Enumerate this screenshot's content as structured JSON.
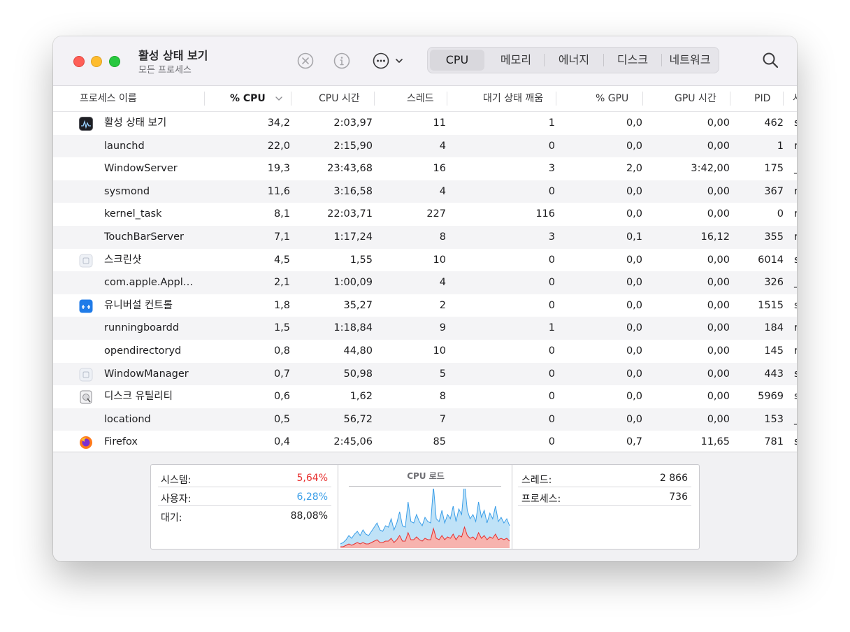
{
  "window": {
    "title": "활성 상태 보기",
    "subtitle": "모든 프로세스"
  },
  "toolbar": {
    "stop_icon": "xmark-circle-icon",
    "info_icon": "info-circle-icon",
    "more_icon": "ellipsis-circle-icon",
    "search_icon": "magnifying-glass-icon",
    "tabs": [
      {
        "label": "CPU",
        "active": true
      },
      {
        "label": "메모리",
        "active": false
      },
      {
        "label": "에너지",
        "active": false
      },
      {
        "label": "디스크",
        "active": false
      },
      {
        "label": "네트워크",
        "active": false
      }
    ]
  },
  "columns": {
    "name": "프로세스 이름",
    "cpu": "% CPU",
    "cpu_time": "CPU 시간",
    "threads": "스레드",
    "idle_wake": "대기 상태 깨움",
    "gpu": "% GPU",
    "gpu_time": "GPU 시간",
    "pid": "PID",
    "user_partial": "사"
  },
  "rows": [
    {
      "name": "활성 상태 보기",
      "icon": "activity-monitor-icon",
      "cpu": "34,2",
      "cpu_time": "2:03,97",
      "threads": "11",
      "idle_wake": "1",
      "gpu": "0,0",
      "gpu_time": "0,00",
      "pid": "462",
      "user": "s"
    },
    {
      "name": "launchd",
      "icon": "",
      "cpu": "22,0",
      "cpu_time": "2:15,90",
      "threads": "4",
      "idle_wake": "0",
      "gpu": "0,0",
      "gpu_time": "0,00",
      "pid": "1",
      "user": "r"
    },
    {
      "name": "WindowServer",
      "icon": "",
      "cpu": "19,3",
      "cpu_time": "23:43,68",
      "threads": "16",
      "idle_wake": "3",
      "gpu": "2,0",
      "gpu_time": "3:42,00",
      "pid": "175",
      "user": "_"
    },
    {
      "name": "sysmond",
      "icon": "",
      "cpu": "11,6",
      "cpu_time": "3:16,58",
      "threads": "4",
      "idle_wake": "0",
      "gpu": "0,0",
      "gpu_time": "0,00",
      "pid": "367",
      "user": "r"
    },
    {
      "name": "kernel_task",
      "icon": "",
      "cpu": "8,1",
      "cpu_time": "22:03,71",
      "threads": "227",
      "idle_wake": "116",
      "gpu": "0,0",
      "gpu_time": "0,00",
      "pid": "0",
      "user": "r"
    },
    {
      "name": "TouchBarServer",
      "icon": "",
      "cpu": "7,1",
      "cpu_time": "1:17,24",
      "threads": "8",
      "idle_wake": "3",
      "gpu": "0,1",
      "gpu_time": "16,12",
      "pid": "355",
      "user": "r"
    },
    {
      "name": "스크린샷",
      "icon": "generic-app-icon",
      "cpu": "4,5",
      "cpu_time": "1,55",
      "threads": "10",
      "idle_wake": "0",
      "gpu": "0,0",
      "gpu_time": "0,00",
      "pid": "6014",
      "user": "s"
    },
    {
      "name": "com.apple.Appl…",
      "icon": "",
      "cpu": "2,1",
      "cpu_time": "1:00,09",
      "threads": "4",
      "idle_wake": "0",
      "gpu": "0,0",
      "gpu_time": "0,00",
      "pid": "326",
      "user": "_"
    },
    {
      "name": "유니버설 컨트롤",
      "icon": "universal-control-icon",
      "cpu": "1,8",
      "cpu_time": "35,27",
      "threads": "2",
      "idle_wake": "0",
      "gpu": "0,0",
      "gpu_time": "0,00",
      "pid": "1515",
      "user": "s"
    },
    {
      "name": "runningboardd",
      "icon": "",
      "cpu": "1,5",
      "cpu_time": "1:18,84",
      "threads": "9",
      "idle_wake": "1",
      "gpu": "0,0",
      "gpu_time": "0,00",
      "pid": "184",
      "user": "r"
    },
    {
      "name": "opendirectoryd",
      "icon": "",
      "cpu": "0,8",
      "cpu_time": "44,80",
      "threads": "10",
      "idle_wake": "0",
      "gpu": "0,0",
      "gpu_time": "0,00",
      "pid": "145",
      "user": "r"
    },
    {
      "name": "WindowManager",
      "icon": "generic-app-icon",
      "cpu": "0,7",
      "cpu_time": "50,98",
      "threads": "5",
      "idle_wake": "0",
      "gpu": "0,0",
      "gpu_time": "0,00",
      "pid": "443",
      "user": "s"
    },
    {
      "name": "디스크 유틸리티",
      "icon": "disk-utility-icon",
      "cpu": "0,6",
      "cpu_time": "1,62",
      "threads": "8",
      "idle_wake": "0",
      "gpu": "0,0",
      "gpu_time": "0,00",
      "pid": "5969",
      "user": "s"
    },
    {
      "name": "locationd",
      "icon": "",
      "cpu": "0,5",
      "cpu_time": "56,72",
      "threads": "7",
      "idle_wake": "0",
      "gpu": "0,0",
      "gpu_time": "0,00",
      "pid": "153",
      "user": "_"
    },
    {
      "name": "Firefox",
      "icon": "firefox-icon",
      "cpu": "0,4",
      "cpu_time": "2:45,06",
      "threads": "85",
      "idle_wake": "0",
      "gpu": "0,7",
      "gpu_time": "11,65",
      "pid": "781",
      "user": "s"
    }
  ],
  "summary": {
    "system_label": "시스템:",
    "system_value": "5,64%",
    "system_color": "#e8302f",
    "user_label": "사용자:",
    "user_value": "6,28%",
    "user_color": "#3a9ee8",
    "idle_label": "대기:",
    "idle_value": "88,08%",
    "chart_title": "CPU 로드",
    "threads_label": "스레드:",
    "threads_value": "2 866",
    "processes_label": "프로세스:",
    "processes_value": "736"
  },
  "cpu_load_history": {
    "user": [
      2,
      3,
      4,
      6,
      5,
      7,
      8,
      6,
      9,
      7,
      6,
      8,
      10,
      12,
      9,
      8,
      11,
      10,
      14,
      9,
      12,
      17,
      11,
      10,
      22,
      13,
      12,
      16,
      13,
      11,
      15,
      13,
      12,
      30,
      14,
      13,
      18,
      12,
      16,
      14,
      20,
      13,
      19,
      16,
      32,
      18,
      14,
      16,
      13,
      22,
      15,
      18,
      12,
      17,
      14,
      20,
      13,
      15,
      12,
      14,
      11
    ],
    "system": [
      1,
      1,
      2,
      3,
      2,
      3,
      4,
      3,
      4,
      3,
      3,
      4,
      5,
      6,
      4,
      4,
      5,
      5,
      7,
      4,
      6,
      9,
      5,
      5,
      11,
      6,
      6,
      8,
      6,
      5,
      7,
      6,
      6,
      14,
      7,
      6,
      9,
      6,
      8,
      7,
      10,
      6,
      9,
      8,
      15,
      9,
      7,
      8,
      6,
      11,
      7,
      9,
      6,
      8,
      7,
      10,
      6,
      7,
      6,
      7,
      5
    ]
  }
}
